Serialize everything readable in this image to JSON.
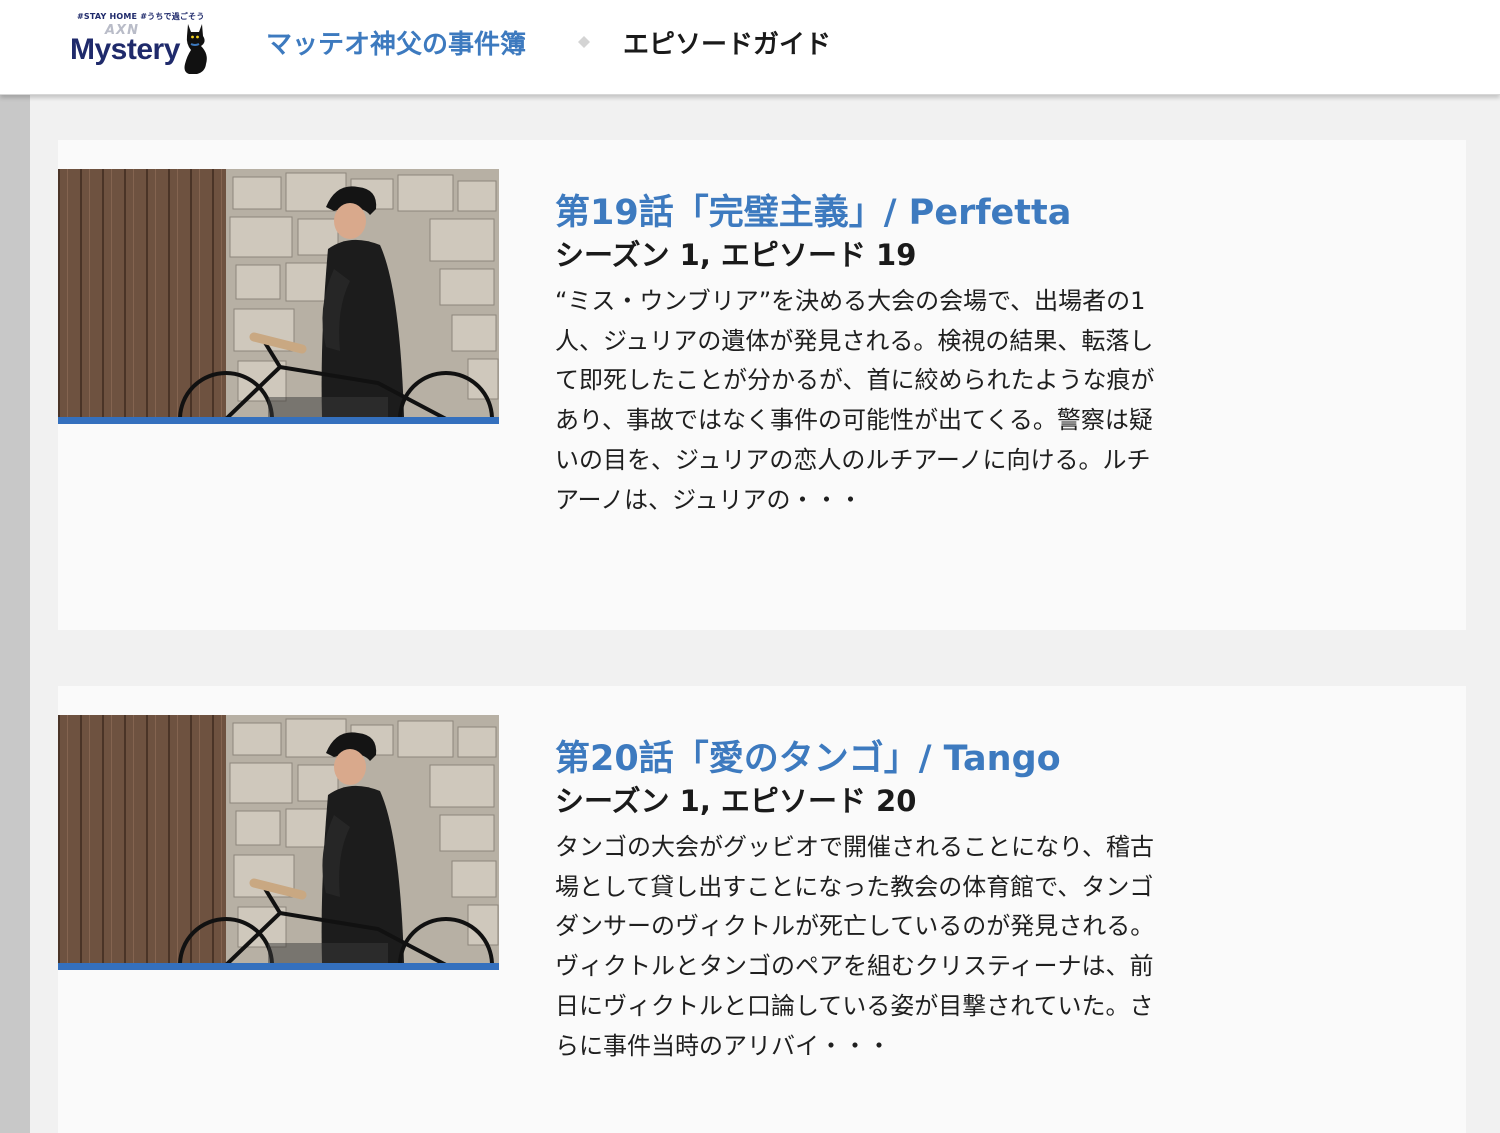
{
  "header": {
    "logo": {
      "tagline": "#STAY HOME  #うちで過ごそう",
      "sub": "AXN",
      "wordmark": "Mystery"
    },
    "show_title": "マッテオ神父の事件簿",
    "current_page": "エピソードガイド"
  },
  "episodes": [
    {
      "title": "第19話「完璧主義」/ Perfetta",
      "subtitle": "シーズン 1, エピソード 19",
      "description": "“ミス・ウンブリア”を決める大会の会場で、出場者の1人、ジュリアの遺体が発見される。検視の結果、転落して即死したことが分かるが、首に絞められたような痕があり、事故ではなく事件の可能性が出てくる。警察は疑いの目を、ジュリアの恋人のルチアーノに向ける。ルチアーノは、ジュリアの・・・"
    },
    {
      "title": "第20話「愛のタンゴ」/ Tango",
      "subtitle": "シーズン 1, エピソード 20",
      "description": "タンゴの大会がグッビオで開催されることになり、稽古場として貸し出すことになった教会の体育館で、タンゴダンサーのヴィクトルが死亡しているのが発見される。ヴィクトルとタンゴのペアを組むクリスティーナは、前日にヴィクトルと口論している姿が目撃されていた。さらに事件当時のアリバイ・・・"
    }
  ],
  "colors": {
    "accent_blue": "#3d7abf",
    "thumb_underline": "#3470be",
    "logo_navy": "#1f2a6b",
    "page_bg": "#f1f1f1",
    "card_bg": "#fafafa"
  }
}
